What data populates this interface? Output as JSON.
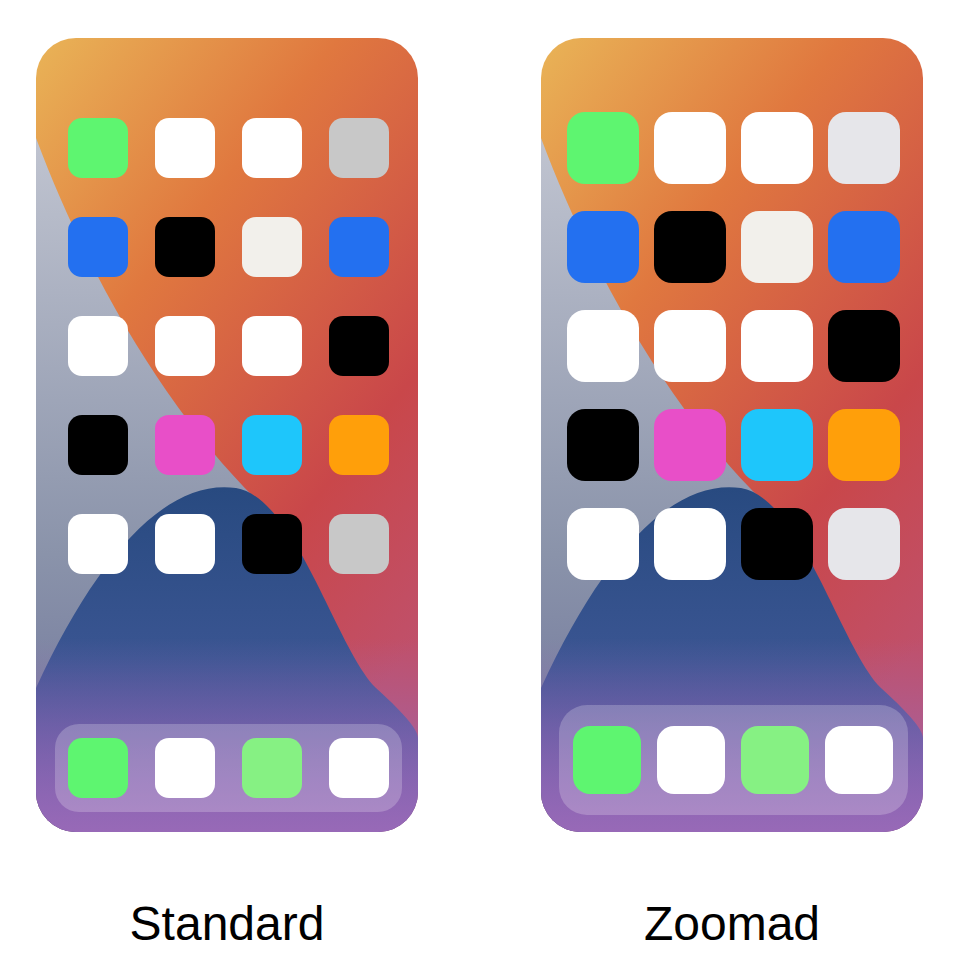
{
  "phones": [
    {
      "label": "Standard",
      "kind": "standard",
      "icons": [
        {
          "color": "#5ef570"
        },
        {
          "color": "#ffffff"
        },
        {
          "color": "#ffffff"
        },
        {
          "color": "#c8c8c8"
        },
        {
          "color": "#2370f0"
        },
        {
          "color": "#000000"
        },
        {
          "color": "#f2f0eb"
        },
        {
          "color": "#2370f0"
        },
        {
          "color": "#ffffff"
        },
        {
          "color": "#ffffff"
        },
        {
          "color": "#ffffff"
        },
        {
          "color": "#000000"
        },
        {
          "color": "#000000"
        },
        {
          "color": "#e84fc8"
        },
        {
          "color": "#1ec6fb"
        },
        {
          "color": "#ff9f0a"
        },
        {
          "color": "#ffffff"
        },
        {
          "color": "#ffffff"
        },
        {
          "color": "#000000"
        },
        {
          "color": "#c8c8c8"
        }
      ],
      "dock": [
        {
          "color": "#5ef570"
        },
        {
          "color": "#ffffff"
        },
        {
          "color": "#86f183"
        },
        {
          "color": "#ffffff"
        }
      ]
    },
    {
      "label": "Zoomad",
      "kind": "zoomed",
      "icons": [
        {
          "color": "#5ef570"
        },
        {
          "color": "#ffffff"
        },
        {
          "color": "#ffffff"
        },
        {
          "color": "#e6e6ea"
        },
        {
          "color": "#2370f0"
        },
        {
          "color": "#000000"
        },
        {
          "color": "#f2f0eb"
        },
        {
          "color": "#2370f0"
        },
        {
          "color": "#ffffff"
        },
        {
          "color": "#ffffff"
        },
        {
          "color": "#ffffff"
        },
        {
          "color": "#000000"
        },
        {
          "color": "#000000"
        },
        {
          "color": "#e84fc8"
        },
        {
          "color": "#1ec6fb"
        },
        {
          "color": "#ff9f0a"
        },
        {
          "color": "#ffffff"
        },
        {
          "color": "#ffffff"
        },
        {
          "color": "#000000"
        },
        {
          "color": "#e6e6ea"
        }
      ],
      "dock": [
        {
          "color": "#5ef570"
        },
        {
          "color": "#ffffff"
        },
        {
          "color": "#86f183"
        },
        {
          "color": "#ffffff"
        }
      ]
    }
  ]
}
